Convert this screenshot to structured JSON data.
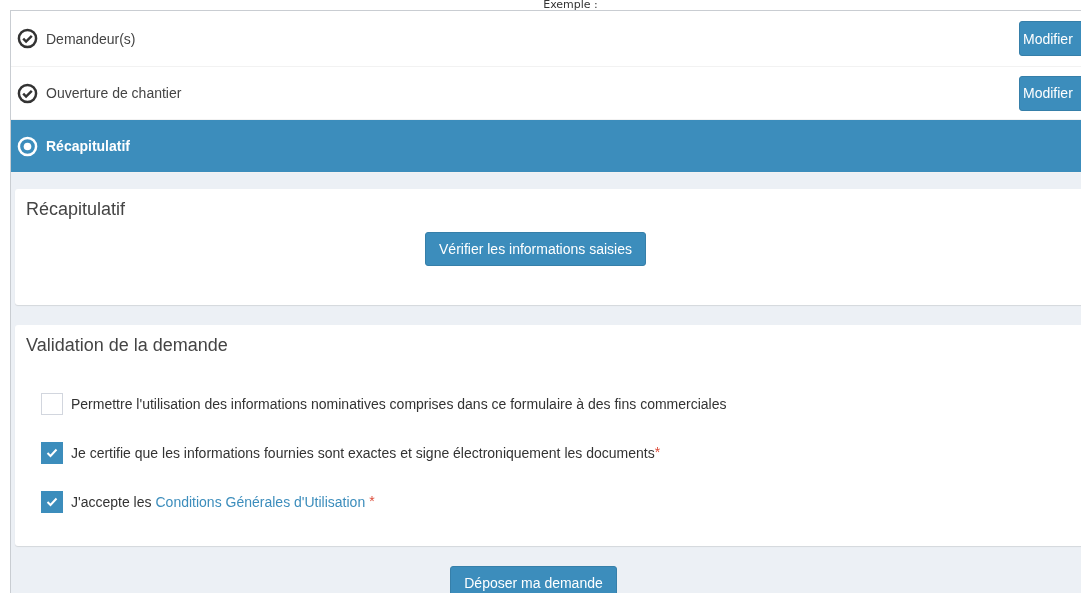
{
  "caption": "Exemple :",
  "steps": [
    {
      "label": "Demandeur(s)",
      "kind": "done",
      "selected": false,
      "button": "Modifier"
    },
    {
      "label": "Ouverture de chantier",
      "kind": "done",
      "selected": false,
      "button": "Modifier"
    },
    {
      "label": "Récapitulatif",
      "kind": "current",
      "selected": true
    }
  ],
  "summary": {
    "title": "Récapitulatif",
    "button": "Vérifier les informations saisies"
  },
  "validation": {
    "title": "Validation de la demande",
    "items": [
      {
        "label": "Permettre l'utilisation des informations nominatives comprises dans ce formulaire à des fins commerciales",
        "checked": false
      },
      {
        "label": "Je certifie que les informations fournies sont exactes et signe électroniquement les documents",
        "checked": true,
        "required_mark": "*"
      },
      {
        "label": "J'accepte les",
        "link": "Conditions Générales d'Utilisation",
        "checked": true,
        "required_mark": "*"
      }
    ]
  },
  "submit": "Déposer ma demande"
}
